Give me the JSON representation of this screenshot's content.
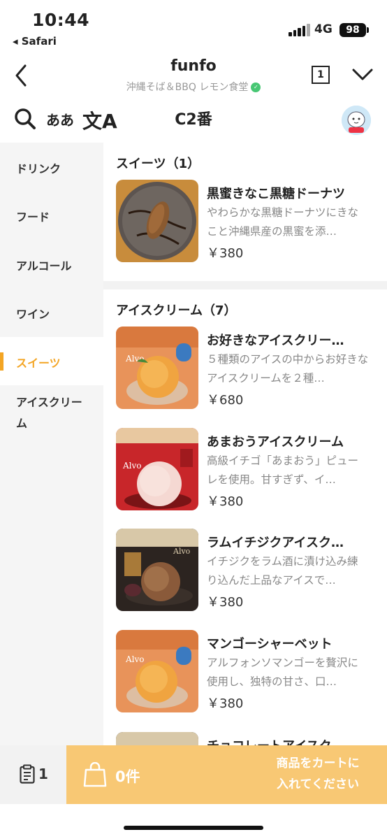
{
  "status": {
    "time": "10:44",
    "back_app": "◂ Safari",
    "network": "4G",
    "battery": "98"
  },
  "header": {
    "title": "funfo",
    "subtitle": "沖縄そば＆BBQ レモン食堂",
    "tab_count": "1"
  },
  "toolbar": {
    "language_label": "ああ",
    "translate_glyph": "文A",
    "seat": "C2番"
  },
  "sidebar": {
    "items": [
      {
        "label": "ドリンク"
      },
      {
        "label": "フード"
      },
      {
        "label": "アルコール"
      },
      {
        "label": "ワイン"
      },
      {
        "label": "スイーツ"
      },
      {
        "label": "アイスクリーム"
      }
    ],
    "active": "スイーツ"
  },
  "sections": [
    {
      "title": "スイーツ（1）",
      "items": [
        {
          "name": "黒蜜きなこ黒糖ドーナツ",
          "desc": "やわらかな黒糖ドーナツにきなこと沖縄県産の黒蜜を添…",
          "price": "￥380"
        }
      ]
    },
    {
      "title": "アイスクリーム（7）",
      "items": [
        {
          "name": "お好きなアイスクリー…",
          "desc": "５種類のアイスの中からお好きなアイスクリームを２種…",
          "price": "￥680"
        },
        {
          "name": "あまおうアイスクリーム",
          "desc": "高級イチゴ「あまおう」ピューレを使用。甘すぎず、イ…",
          "price": "￥380"
        },
        {
          "name": "ラムイチジクアイスク…",
          "desc": "イチジクをラム酒に漬け込み練り込んだ上品なアイスで…",
          "price": "￥380"
        },
        {
          "name": "マンゴーシャーベット",
          "desc": "アルフォンソマンゴーを贅沢に使用し、独特の甘さ、口…",
          "price": "￥380"
        },
        {
          "name": "チョコレートアイスク…",
          "desc": "",
          "price": ""
        }
      ]
    }
  ],
  "bottom": {
    "history_count": "1",
    "cart_count": "0件",
    "cart_message_1": "商品をカートに",
    "cart_message_2": "入れてください"
  },
  "colors": {
    "accent": "#f3a524",
    "cart_bg": "#f8c874",
    "sidebar_bg": "#f5f5f5"
  }
}
